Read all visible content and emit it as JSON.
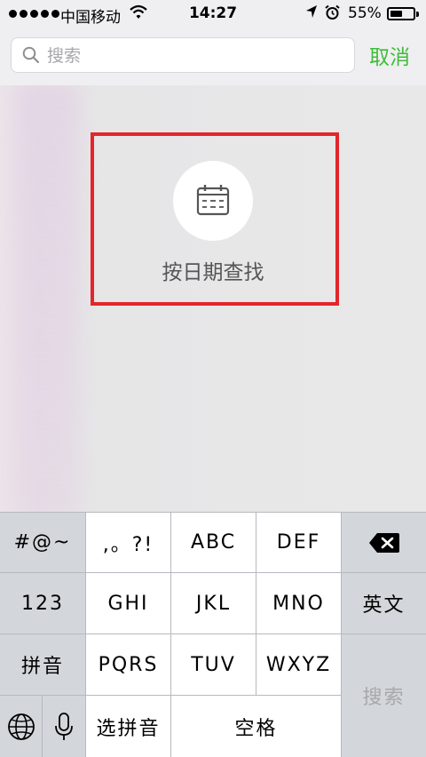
{
  "status_bar": {
    "carrier": "中国移动",
    "time": "14:27",
    "battery_percent": "55%",
    "battery_level": 0.55,
    "signal_bars": 5
  },
  "search": {
    "placeholder": "搜索",
    "value": "",
    "cancel_label": "取消"
  },
  "content": {
    "date_search_label": "按日期查找",
    "highlight_color": "#e3262c"
  },
  "keyboard": {
    "rows": [
      [
        "#@~",
        ",。?!",
        "ABC",
        "DEF",
        "delete-icon"
      ],
      [
        "123",
        "GHI",
        "JKL",
        "MNO",
        "英文"
      ],
      [
        "拼音",
        "PQRS",
        "TUV",
        "WXYZ",
        "搜索"
      ],
      [
        "globe-icon",
        "mic-icon",
        "选拼音",
        "空格"
      ]
    ],
    "k_symbols": "#@~",
    "k_punct": ",。?!",
    "k_abc": "ABC",
    "k_def": "DEF",
    "k_123": "123",
    "k_ghi": "GHI",
    "k_jkl": "JKL",
    "k_mno": "MNO",
    "k_english": "英文",
    "k_pinyin": "拼音",
    "k_pqrs": "PQRS",
    "k_tuv": "TUV",
    "k_wxyz": "WXYZ",
    "k_search": "搜索",
    "k_select_pinyin": "选拼音",
    "k_space": "空格"
  },
  "colors": {
    "accent_green": "#3fbc3a",
    "highlight_red": "#e3262c",
    "keyboard_bg": "#b6b9be"
  }
}
